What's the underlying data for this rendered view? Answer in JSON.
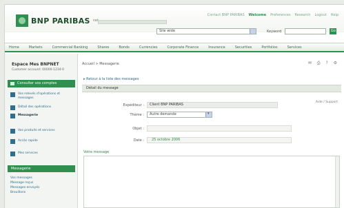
{
  "header": {
    "brand": "BNP PARIBAS",
    "brand_suffix": "net",
    "top_links": [
      "Contact BNP PARIBAS",
      "Welcome",
      "Preferences",
      "Research",
      "Logout",
      "Help"
    ],
    "search_select": "Site wide",
    "search_label": "Keyword",
    "go_label": "Go"
  },
  "nav": {
    "items": [
      "Home",
      "Markets",
      "Commercial Banking",
      "Shares",
      "Bonds",
      "Currencies",
      "Corporate Finance",
      "Insurance",
      "Securities",
      "Portfolios",
      "Services"
    ]
  },
  "sidebar": {
    "user_name": "Espace Mes BNPNET",
    "user_sub": "Customer account: 00000-1234-0",
    "active_item": "Consulter vos comptes",
    "items": [
      {
        "label": "Vos relevés d'opérations et messages",
        "bold": false
      },
      {
        "label": "Détail des opérations",
        "bold": false
      },
      {
        "label": "Messagerie",
        "bold": true
      },
      {
        "label": "Vos produits et services",
        "bold": false
      },
      {
        "label": "Accès rapide",
        "bold": false
      },
      {
        "label": "Mes services",
        "bold": false
      }
    ],
    "section_head": "Messagerie",
    "sub_items": [
      "Vos messages",
      "Message reçus",
      "Messages envoyés",
      "Brouillons"
    ]
  },
  "main": {
    "breadcrumb": "Accueil > Messagerie",
    "page_icons": "✉ ⎙ ? ⚙",
    "collapse_link": "▸ Retour à la liste des messages",
    "section_title": "Détail du message",
    "help_link": "Aide / Support",
    "fields": {
      "from_label": "Expéditeur :",
      "from_value": "Client BNP PARIBAS",
      "topic_label": "Thème :",
      "topic_value": "Autre demande",
      "subject_label": "Objet :",
      "subject_value": "",
      "date_label": "Date :",
      "date_value": "25 octobre 2006"
    },
    "message_label": "Votre message"
  }
}
